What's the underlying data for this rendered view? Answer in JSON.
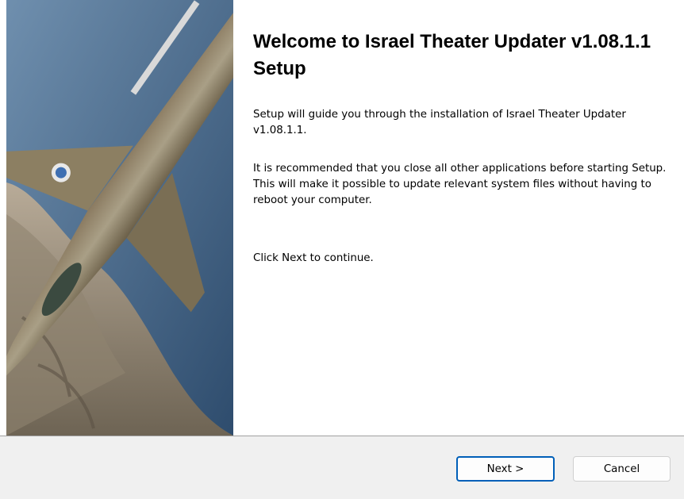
{
  "wizard": {
    "title": "Welcome to Israel Theater Updater v1.08.1.1 Setup",
    "paragraphs": [
      "Setup will guide you through the installation of Israel Theater Updater v1.08.1.1.",
      "It is recommended that you close all other applications before starting Setup. This will make it possible to update relevant system files without having to reboot your computer.",
      "Click Next to continue."
    ],
    "banner_image": "fighter-jet-over-coastline"
  },
  "buttons": {
    "next_label": "Next >",
    "cancel_label": "Cancel"
  },
  "colors": {
    "accent": "#005fb8",
    "footer_bg": "#f0f0f0",
    "sea": "#3c5a7a",
    "terrain": "#9a8c78"
  }
}
